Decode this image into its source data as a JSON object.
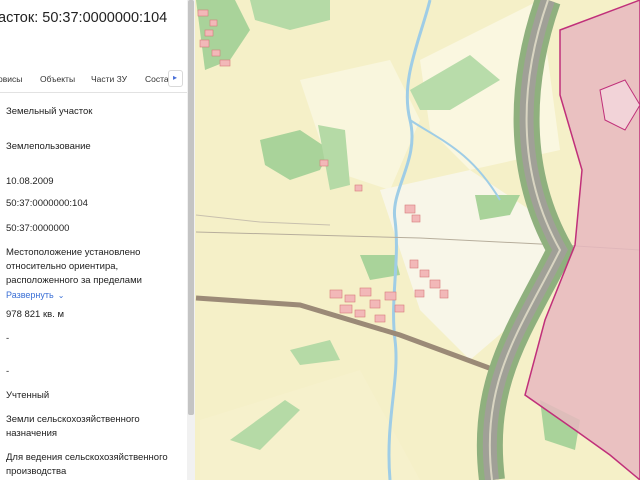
{
  "panel": {
    "title": "асток: 50:37:0000000:104",
    "tabs": [
      "рвисы",
      "Объекты",
      "Части ЗУ",
      "Соста"
    ],
    "tab_next_icon": "▸",
    "rows": [
      "Земельный участок",
      "Землепользование",
      "10.08.2009",
      "50:37:0000000:104",
      "50:37:0000000",
      "Местоположение установлено относительно ориентира, расположенного за пределами",
      "978 821 кв. м",
      "-",
      "-",
      "Учтенный",
      "Земли сельскохозяйственного назначения",
      "Для ведения сельскохозяйственного производства"
    ],
    "expand_label": "Развернуть",
    "expand_icon": "⌄"
  },
  "map": {
    "colors": {
      "background": "#f5f0c8",
      "field": "#f8f4d5",
      "forest": "#a9d39a",
      "water": "#9fcde6",
      "road": "#9b8a77",
      "parcel_fill": "#e8b8c0",
      "parcel_stroke": "#c0307a",
      "building": "#f2b8b8",
      "highway_verge": "#8fb07e"
    }
  }
}
